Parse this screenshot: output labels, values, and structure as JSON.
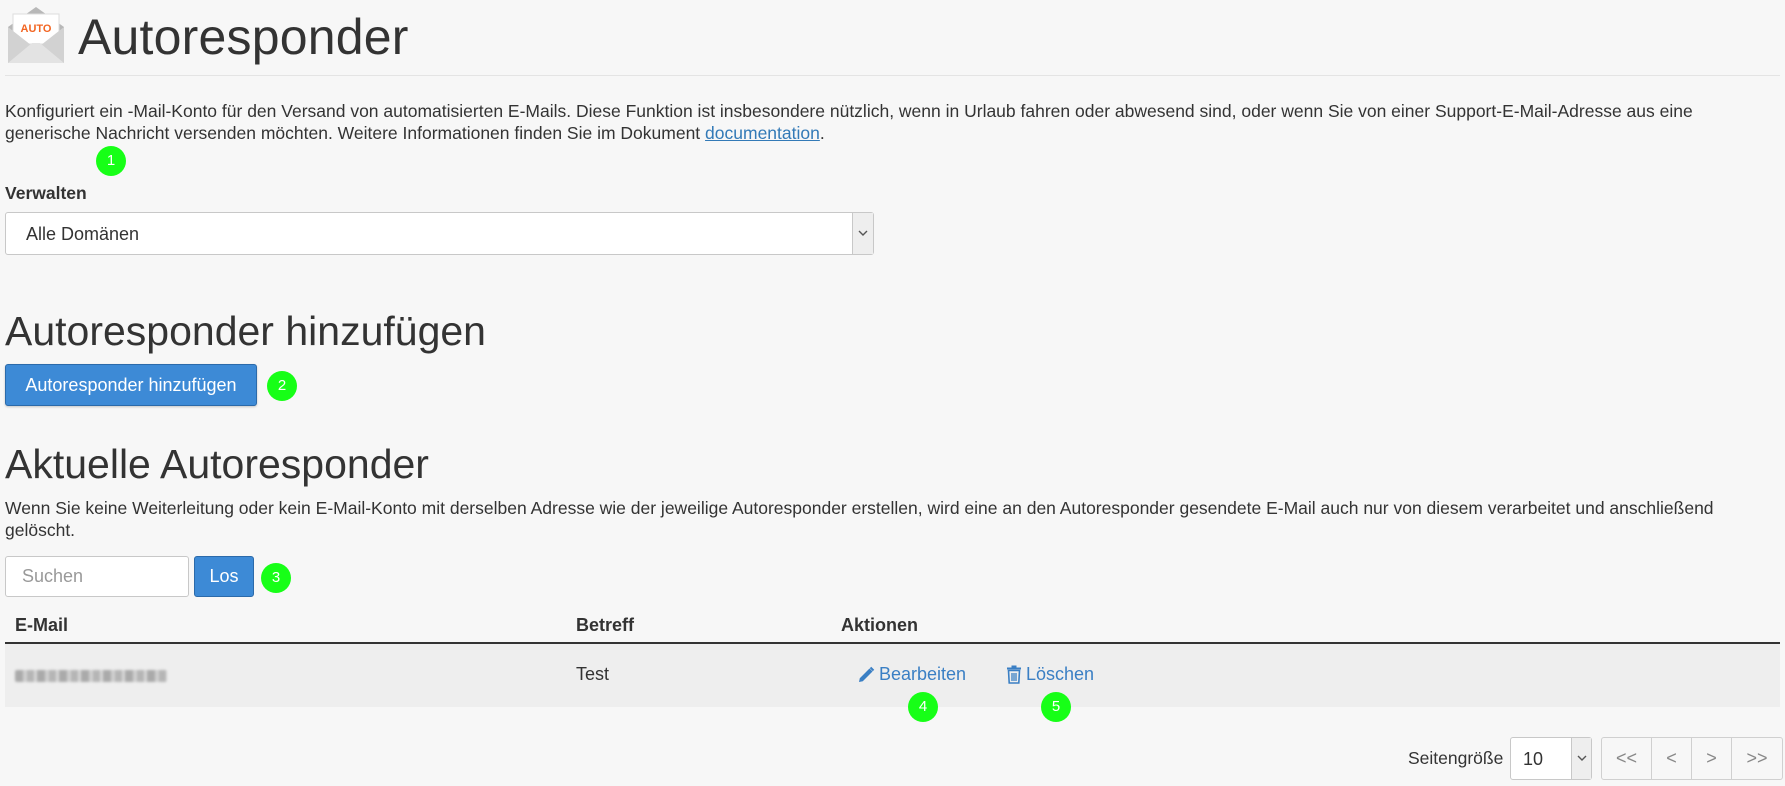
{
  "header": {
    "icon_label": "AUTO",
    "title": "Autoresponder"
  },
  "description": {
    "text": "Konfiguriert ein -Mail-Konto für den Versand von automatisierten E-Mails. Diese Funktion ist insbesondere nützlich, wenn in Urlaub fahren oder abwesend sind, oder wenn Sie von einer Support-E-Mail-Adresse aus eine generische Nachricht versenden möchten. Weitere Informationen finden Sie im Dokument ",
    "link": "documentation",
    "tail": "."
  },
  "manage": {
    "label": "Verwalten",
    "selected": "Alle Domänen"
  },
  "add_section": {
    "heading": "Autoresponder hinzufügen",
    "button": "Autoresponder hinzufügen"
  },
  "current_section": {
    "heading": "Aktuelle Autoresponder",
    "info": "Wenn Sie keine Weiterleitung oder kein E-Mail-Konto mit derselben Adresse wie der jeweilige Autoresponder erstellen, wird eine an den Autoresponder gesendete E-Mail auch nur von diesem verarbeitet und anschließend gelöscht.",
    "search_placeholder": "Suchen",
    "go_button": "Los"
  },
  "table": {
    "columns": [
      "E-Mail",
      "Betreff",
      "Aktionen"
    ],
    "rows": [
      {
        "subject": "Test",
        "edit": "Bearbeiten",
        "delete": "Löschen"
      }
    ]
  },
  "pagination": {
    "page_size_label": "Seitengröße",
    "page_size": "10",
    "buttons": [
      "<<",
      "<",
      ">",
      ">>"
    ]
  },
  "badges": [
    "1",
    "2",
    "3",
    "4",
    "5"
  ],
  "colors": {
    "primary": "#3d8ad6",
    "link": "#337ab7",
    "badge": "#17ff17",
    "icon_orange": "#f26522"
  }
}
